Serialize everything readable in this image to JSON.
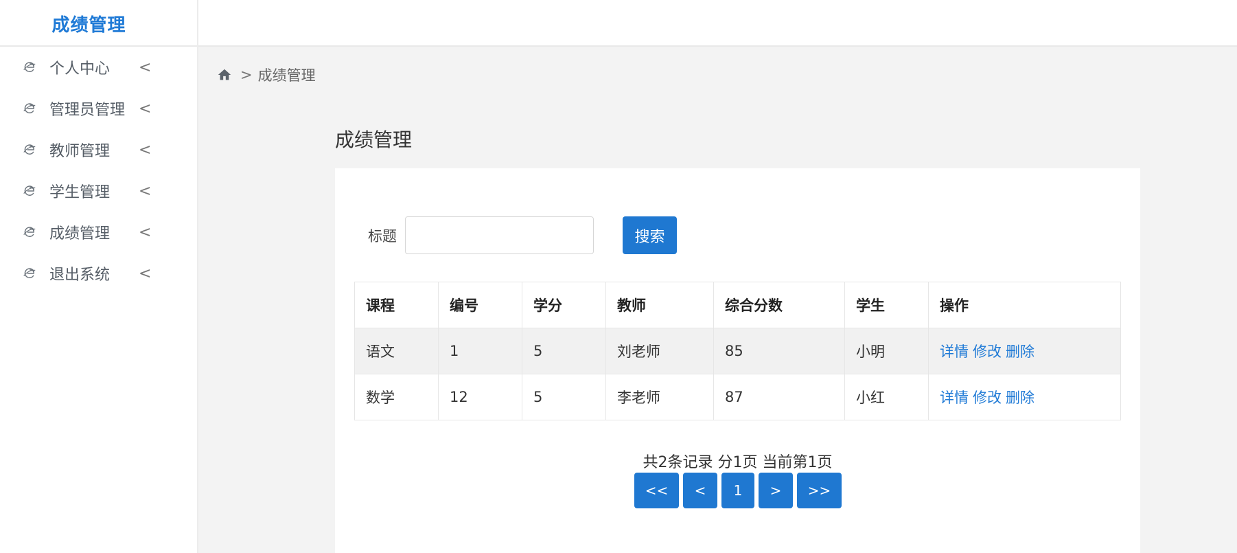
{
  "app": {
    "title": "成绩管理"
  },
  "sidebar": {
    "items": [
      {
        "label": "个人中心"
      },
      {
        "label": "管理员管理"
      },
      {
        "label": "教师管理"
      },
      {
        "label": "学生管理"
      },
      {
        "label": "成绩管理"
      },
      {
        "label": "退出系统"
      }
    ],
    "chevron": "<"
  },
  "breadcrumb": {
    "separator": ">",
    "current": "成绩管理"
  },
  "page": {
    "title": "成绩管理"
  },
  "search": {
    "label": "标题",
    "value": "",
    "button": "搜索"
  },
  "table": {
    "headers": [
      "课程",
      "编号",
      "学分",
      "教师",
      "综合分数",
      "学生",
      "操作"
    ],
    "rows": [
      {
        "course": "语文",
        "id": "1",
        "credit": "5",
        "teacher": "刘老师",
        "score": "85",
        "student": "小明"
      },
      {
        "course": "数学",
        "id": "12",
        "credit": "5",
        "teacher": "李老师",
        "score": "87",
        "student": "小红"
      }
    ],
    "actions": {
      "detail": "详情",
      "edit": "修改",
      "delete": "删除"
    }
  },
  "pagination": {
    "info": "共2条记录 分1页 当前第1页",
    "first": "<<",
    "prev": "<",
    "current": "1",
    "next": ">",
    "last": ">>"
  },
  "colors": {
    "accent": "#1f78d1",
    "link": "#1f7ad6",
    "background": "#f3f3f3"
  },
  "icons": {
    "nav": "ie-e-icon",
    "home": "home-icon"
  }
}
